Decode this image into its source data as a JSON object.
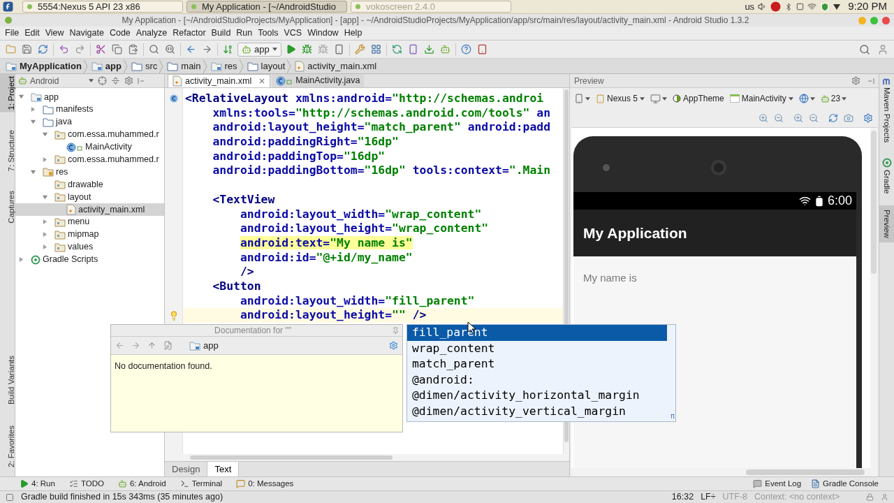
{
  "taskbar": {
    "windows": [
      {
        "title": "5554:Nexus 5  API 23  x86",
        "selected": false,
        "minimized": false
      },
      {
        "title": "My Application - [~/AndroidStudio",
        "selected": true,
        "minimized": false
      },
      {
        "title": "vokoscreen 2.4.0",
        "selected": false,
        "minimized": true
      }
    ],
    "keyboard": "us",
    "clock": "9:20 PM"
  },
  "window": {
    "title": "My Application - [~/AndroidStudioProjects/MyApplication] - [app] - ~/AndroidStudioProjects/MyApplication/app/src/main/res/layout/activity_main.xml - Android Studio 1.3.2"
  },
  "menu_bar": [
    "File",
    "Edit",
    "View",
    "Navigate",
    "Code",
    "Analyze",
    "Refactor",
    "Build",
    "Run",
    "Tools",
    "VCS",
    "Window",
    "Help"
  ],
  "toolbar": {
    "run_config": "app"
  },
  "breadcrumbs": [
    {
      "label": "MyApplication",
      "kind": "module"
    },
    {
      "label": "app",
      "kind": "module"
    },
    {
      "label": "src",
      "kind": "folder"
    },
    {
      "label": "main",
      "kind": "folder"
    },
    {
      "label": "res",
      "kind": "module"
    },
    {
      "label": "layout",
      "kind": "folder"
    },
    {
      "label": "activity_main.xml",
      "kind": "xml"
    }
  ],
  "left_stripe": {
    "top": [
      {
        "label": "1: Project",
        "selected": true
      },
      {
        "label": "7: Structure",
        "selected": false
      },
      {
        "label": "Captures",
        "selected": false
      }
    ],
    "bottom": [
      {
        "label": "Build Variants",
        "selected": false
      },
      {
        "label": "2: Favorites",
        "selected": false
      }
    ]
  },
  "project": {
    "view": "Android",
    "tree": [
      {
        "label": "app",
        "kind": "module",
        "expanded": true,
        "selected": false,
        "children": [
          {
            "label": "manifests",
            "kind": "folder",
            "expanded": false,
            "selected": false
          },
          {
            "label": "java",
            "kind": "folder",
            "expanded": true,
            "selected": false,
            "children": [
              {
                "label": "com.essa.muhammed.r",
                "kind": "package",
                "expanded": true,
                "selected": false,
                "children": [
                  {
                    "label": "MainActivity",
                    "kind": "class",
                    "selected": false
                  }
                ]
              },
              {
                "label": "com.essa.muhammed.r",
                "kind": "package",
                "expanded": false,
                "selected": false
              }
            ]
          },
          {
            "label": "res",
            "kind": "res",
            "expanded": true,
            "selected": false,
            "children": [
              {
                "label": "drawable",
                "kind": "package",
                "selected": false
              },
              {
                "label": "layout",
                "kind": "package",
                "expanded": true,
                "selected": false,
                "children": [
                  {
                    "label": "activity_main.xml",
                    "kind": "xml",
                    "selected": true
                  }
                ]
              },
              {
                "label": "menu",
                "kind": "package",
                "expanded": false,
                "selected": false
              },
              {
                "label": "mipmap",
                "kind": "package",
                "expanded": false,
                "selected": false
              },
              {
                "label": "values",
                "kind": "package",
                "expanded": false,
                "selected": false
              }
            ]
          }
        ]
      },
      {
        "label": "Gradle Scripts",
        "kind": "gradle",
        "expanded": false,
        "selected": false
      }
    ]
  },
  "editor": {
    "tabs": [
      {
        "label": "activity_main.xml",
        "kind": "xml",
        "selected": true
      },
      {
        "label": "MainActivity.java",
        "kind": "class",
        "selected": false
      }
    ],
    "lines": [
      {
        "kind": "declaration",
        "highlighted": false,
        "current": false,
        "tokens": [
          {
            "kind": "tag",
            "text": "<RelativeLayout "
          },
          {
            "kind": "attr",
            "text": "xmlns:android="
          },
          {
            "kind": "value",
            "text": "\"http://schemas.androi"
          }
        ]
      },
      {
        "kind": "plain",
        "highlighted": false,
        "current": false,
        "tokens": [
          {
            "kind": "attr",
            "text": "    xmlns:tools="
          },
          {
            "kind": "value",
            "text": "\"http://schemas.android.com/tools\" "
          },
          {
            "kind": "attr",
            "text": "an"
          }
        ]
      },
      {
        "kind": "plain",
        "highlighted": false,
        "current": false,
        "tokens": [
          {
            "kind": "attr",
            "text": "    android:layout_height="
          },
          {
            "kind": "value",
            "text": "\"match_parent\" "
          },
          {
            "kind": "attr",
            "text": "android:padd"
          }
        ]
      },
      {
        "kind": "plain",
        "highlighted": false,
        "current": false,
        "tokens": [
          {
            "kind": "attr",
            "text": "    android:paddingRight="
          },
          {
            "kind": "value",
            "text": "\"16dp\""
          }
        ]
      },
      {
        "kind": "plain",
        "highlighted": false,
        "current": false,
        "tokens": [
          {
            "kind": "attr",
            "text": "    android:paddingTop="
          },
          {
            "kind": "value",
            "text": "\"16dp\""
          }
        ]
      },
      {
        "kind": "plain",
        "highlighted": false,
        "current": false,
        "tokens": [
          {
            "kind": "attr",
            "text": "    android:paddingBottom="
          },
          {
            "kind": "value",
            "text": "\"16dp\" "
          },
          {
            "kind": "attr",
            "text": "tools:context="
          },
          {
            "kind": "value",
            "text": "\".Main"
          }
        ]
      },
      {
        "kind": "plain",
        "current": false
      },
      {
        "kind": "plain",
        "highlighted": false,
        "current": false,
        "tokens": [
          {
            "kind": "tag",
            "text": "    <TextView"
          }
        ]
      },
      {
        "kind": "plain",
        "highlighted": false,
        "current": false,
        "tokens": [
          {
            "kind": "attr",
            "text": "        android:layout_width="
          },
          {
            "kind": "value",
            "text": "\"wrap_content\""
          }
        ]
      },
      {
        "kind": "plain",
        "highlighted": false,
        "current": false,
        "tokens": [
          {
            "kind": "attr",
            "text": "        android:layout_height="
          },
          {
            "kind": "value",
            "text": "\"wrap_content\""
          }
        ]
      },
      {
        "kind": "plain",
        "highlighted": true,
        "current": false,
        "tokens": [
          {
            "kind": "attr",
            "text": "        android:text="
          },
          {
            "kind": "value",
            "text": "\"My name is\""
          }
        ]
      },
      {
        "kind": "plain",
        "highlighted": false,
        "current": false,
        "tokens": [
          {
            "kind": "attr",
            "text": "        android:id="
          },
          {
            "kind": "value",
            "text": "\"@+id/my_name\""
          }
        ]
      },
      {
        "kind": "plain",
        "highlighted": false,
        "current": false,
        "tokens": [
          {
            "kind": "tag",
            "text": "        />"
          }
        ]
      },
      {
        "kind": "plain",
        "highlighted": false,
        "current": false,
        "tokens": [
          {
            "kind": "tag",
            "text": "    <Button"
          }
        ]
      },
      {
        "kind": "plain",
        "highlighted": false,
        "current": false,
        "tokens": [
          {
            "kind": "attr",
            "text": "        android:layout_width="
          },
          {
            "kind": "value",
            "text": "\"fill_parent\""
          }
        ]
      },
      {
        "kind": "plain",
        "highlighted": false,
        "current": true,
        "tokens": [
          {
            "kind": "attr",
            "text": "        android:layout_height="
          },
          {
            "kind": "value",
            "text": "\"\" "
          },
          {
            "kind": "tag",
            "text": "/>"
          }
        ]
      }
    ],
    "mode_tabs": [
      {
        "label": "Design",
        "selected": false
      },
      {
        "label": "Text",
        "selected": true
      }
    ]
  },
  "documentation": {
    "title": "Documentation for \"\"",
    "location": "app",
    "body": "No documentation found."
  },
  "completion": {
    "items": [
      {
        "label": "fill_parent",
        "selected": true
      },
      {
        "label": "wrap_content",
        "selected": false
      },
      {
        "label": "match_parent",
        "selected": false
      },
      {
        "label": "@android:",
        "selected": false
      },
      {
        "label": "@dimen/activity_horizontal_margin",
        "selected": false
      },
      {
        "label": "@dimen/activity_vertical_margin",
        "selected": false
      }
    ],
    "corner": "π"
  },
  "preview": {
    "title": "Preview",
    "device": "Nexus 5",
    "theme": "AppTheme",
    "activity": "MainActivity",
    "api": "23",
    "phone": {
      "clock": "6:00",
      "app_title": "My Application",
      "text": "My name is"
    }
  },
  "right_stripe": [
    {
      "label": "Maven Projects",
      "kind": "maven",
      "selected": false
    },
    {
      "label": "Gradle",
      "kind": "gradle",
      "selected": false
    },
    {
      "label": "Preview",
      "kind": "none",
      "selected": true
    }
  ],
  "tool_windows": {
    "left": [
      {
        "label": "4: Run",
        "kind": "run"
      },
      {
        "label": "TODO",
        "kind": "todo"
      },
      {
        "label": "6: Android",
        "kind": "android"
      },
      {
        "label": "Terminal",
        "kind": "terminal"
      },
      {
        "label": "0: Messages",
        "kind": "messages"
      }
    ],
    "right": [
      {
        "label": "Event Log",
        "kind": "log"
      },
      {
        "label": "Gradle Console",
        "kind": "console"
      }
    ]
  },
  "status": {
    "message": "Gradle build finished in 15s 343ms (35 minutes ago)",
    "position": "16:32",
    "line_separator": "LF÷",
    "encoding": "UTF-8",
    "context": "Context: <no context>"
  }
}
